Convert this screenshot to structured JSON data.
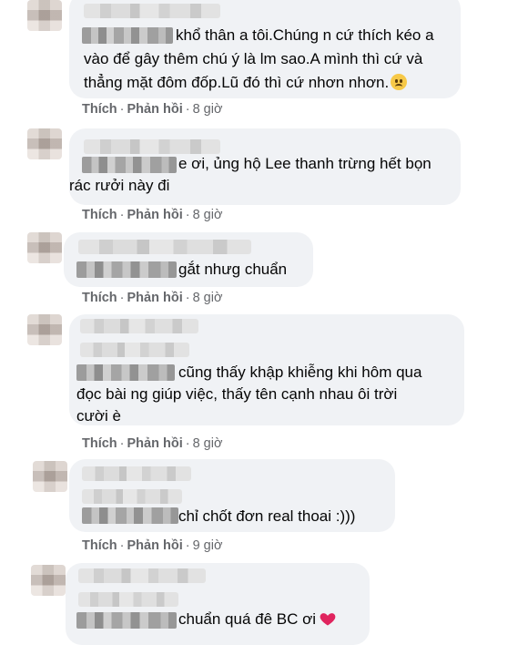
{
  "comments": [
    {
      "lines": [
        "khổ thân a tôi.Chúng n cứ thích kéo a",
        "vào để gây thêm chú ý là lm sao.A mình thì cứ và",
        "thẳng mặt đôm đốp.Lũ đó thì cứ nhơn nhơn."
      ],
      "emoji": "sad-face-emoji",
      "like": "Thích",
      "reply": "Phản hồi",
      "time": "8 giờ"
    },
    {
      "lines": [
        "e ơi, ủng hộ Lee thanh trừng hết bọn",
        "rác rưởi này đi"
      ],
      "like": "Thích",
      "reply": "Phản hồi",
      "time": "8 giờ"
    },
    {
      "lines": [
        "gắt nhưg chuẩn"
      ],
      "like": "Thích",
      "reply": "Phản hồi",
      "time": "8 giờ"
    },
    {
      "lines": [
        "cũng thấy khập khiễng khi hôm qua",
        "đọc bài ng giúp việc, thấy tên cạnh nhau ôi trời",
        "cười è"
      ],
      "like": "Thích",
      "reply": "Phản hồi",
      "time": "8 giờ"
    },
    {
      "lines": [
        "chỉ chốt đơn real thoai :)))"
      ],
      "like": "Thích",
      "reply": "Phản hồi",
      "time": "9 giờ"
    },
    {
      "lines": [
        "chuẩn quá đê BC ơi"
      ],
      "emoji": "red-heart-emoji"
    }
  ],
  "colors": {
    "bubble": "#f0f2f5",
    "meta": "#65676b",
    "text": "#050505",
    "heart": "#e0245e"
  },
  "separator": "·"
}
